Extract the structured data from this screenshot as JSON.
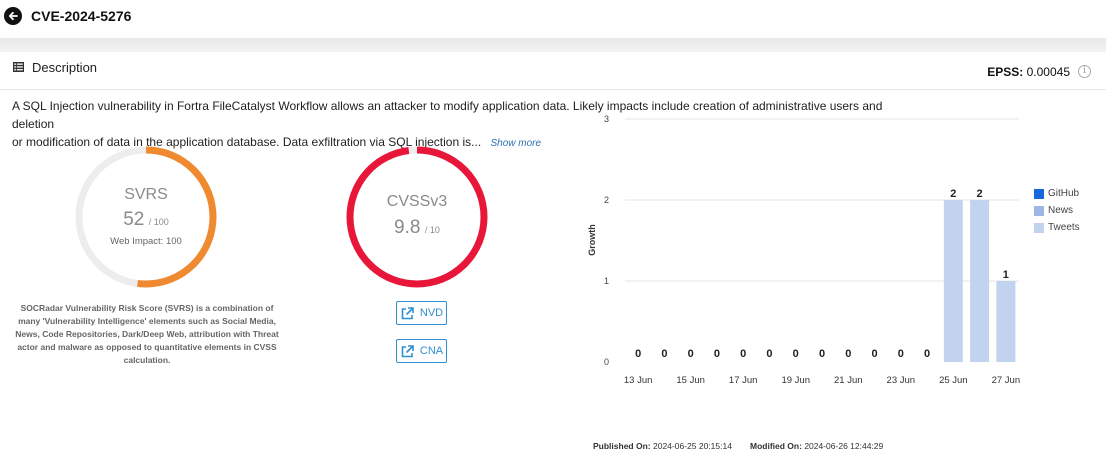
{
  "header": {
    "title": "CVE-2024-5276"
  },
  "card": {
    "section_label": "Description",
    "epss_label": "EPSS:",
    "epss_value": "0.00045",
    "description_line1": "A SQL Injection vulnerability in Fortra FileCatalyst Workflow allows an attacker to modify application data.  Likely impacts include creation of administrative users and deletion",
    "description_line2": "or modification of data in the application database. Data exfiltration via SQL injection is...",
    "show_more": "Show more"
  },
  "svrs": {
    "title": "SVRS",
    "score": "52",
    "max": "/ 100",
    "web_impact": "Web Impact: 100",
    "fraction": 0.52,
    "color": "#f08a30",
    "note": "SOCRadar Vulnerability Risk Score (SVRS) is a combination of many 'Vulnerability Intelligence' elements such as Social Media, News, Code Repositories, Dark/Deep Web, attribution with Threat actor and malware as opposed to quantitative elements in CVSS calculation."
  },
  "cvss": {
    "title": "CVSSv3",
    "score": "9.8",
    "max": "/ 10",
    "fraction": 0.98,
    "color": "#e8173a",
    "nvd_label": "NVD",
    "cna_label": "CNA"
  },
  "chart_data": {
    "type": "bar",
    "ylabel": "Growth",
    "ylim": [
      0,
      3
    ],
    "yticks": [
      "0",
      "1",
      "2",
      "3"
    ],
    "x_labels": [
      "13 Jun",
      "15 Jun",
      "17 Jun",
      "19 Jun",
      "21 Jun",
      "23 Jun",
      "25 Jun",
      "27 Jun"
    ],
    "categories": [
      "13 Jun",
      "14 Jun",
      "15 Jun",
      "16 Jun",
      "17 Jun",
      "18 Jun",
      "19 Jun",
      "20 Jun",
      "21 Jun",
      "22 Jun",
      "23 Jun",
      "24 Jun",
      "25 Jun",
      "26 Jun",
      "27 Jun"
    ],
    "values": [
      0,
      0,
      0,
      0,
      0,
      0,
      0,
      0,
      0,
      0,
      0,
      0,
      2,
      2,
      1
    ],
    "legend": [
      {
        "name": "GitHub",
        "color": "#1668dc"
      },
      {
        "name": "News",
        "color": "#9db8e4"
      },
      {
        "name": "Tweets",
        "color": "#c2d3ef"
      }
    ],
    "bar_color": "#c2d3ef"
  },
  "footer": {
    "published_label": "Published On:",
    "published_value": "2024-06-25 20:15:14",
    "modified_label": "Modified On:",
    "modified_value": "2024-06-26 12:44:29"
  }
}
